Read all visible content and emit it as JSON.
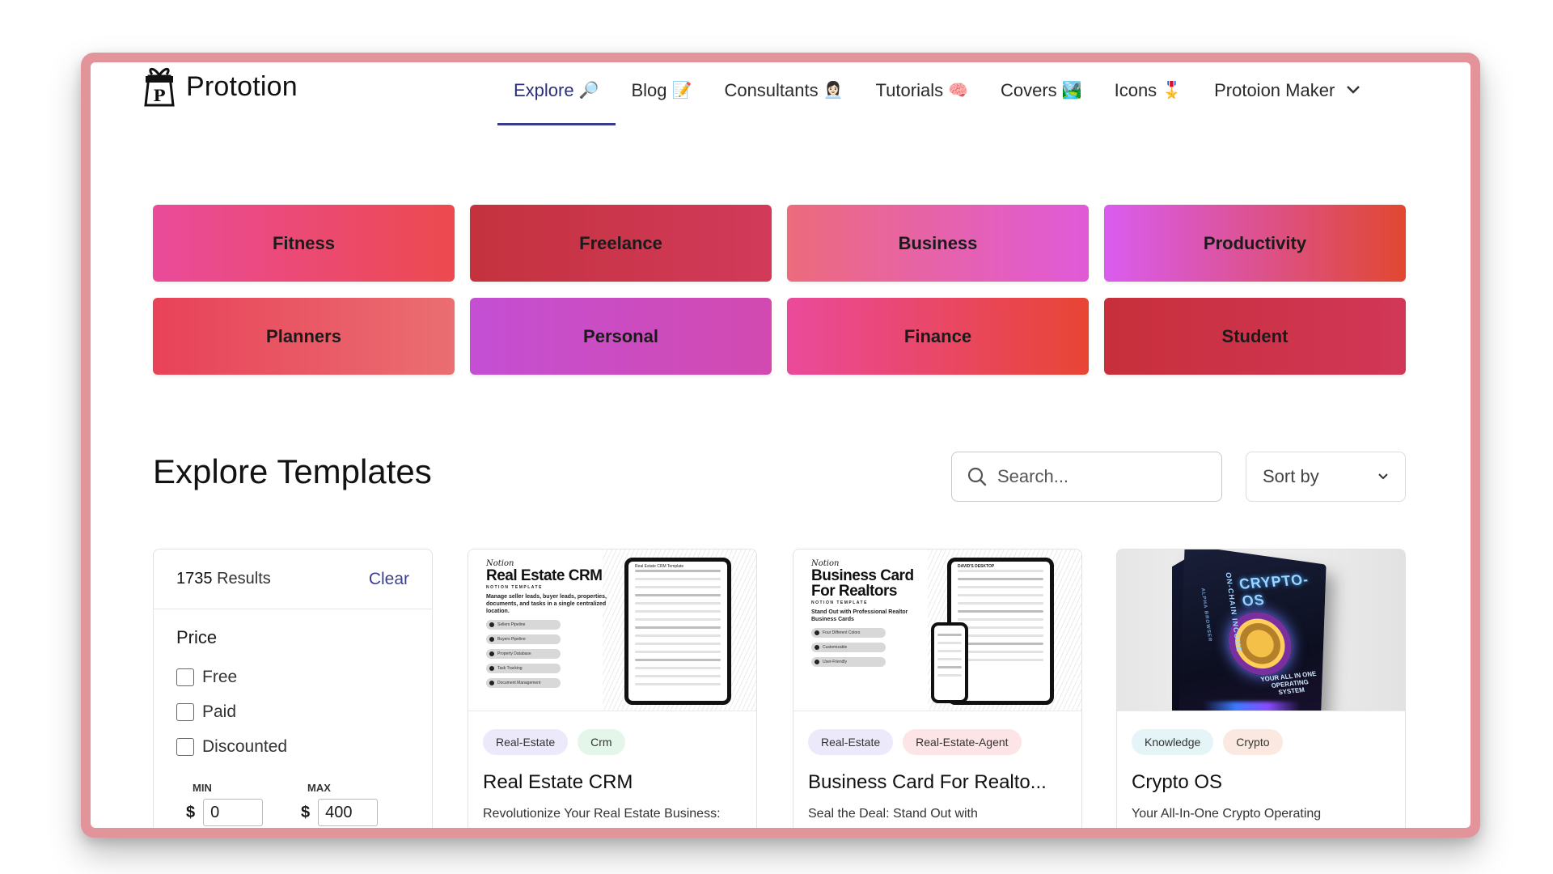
{
  "brand": {
    "name": "Prototion",
    "logo_letter": "P"
  },
  "nav": {
    "items": [
      {
        "label": "Explore",
        "emoji": "🔎",
        "active": true
      },
      {
        "label": "Blog",
        "emoji": "📝"
      },
      {
        "label": "Consultants",
        "emoji": "👩🏻‍💼"
      },
      {
        "label": "Tutorials",
        "emoji": "🧠"
      },
      {
        "label": "Covers",
        "emoji": "🏞️"
      },
      {
        "label": "Icons",
        "emoji": "🎖️"
      }
    ],
    "maker_label": "Protoion Maker",
    "maker_chevron": "⌄"
  },
  "categories": [
    "Fitness",
    "Freelance",
    "Business",
    "Productivity",
    "Planners",
    "Personal",
    "Finance",
    "Student"
  ],
  "explore": {
    "title": "Explore Templates",
    "search_placeholder": "Search...",
    "sort_label": "Sort by",
    "sort_chevron": "⌄"
  },
  "filter": {
    "count": "1735",
    "results_label": "Results",
    "clear_label": "Clear",
    "price_label": "Price",
    "options": [
      "Free",
      "Paid",
      "Discounted"
    ],
    "min_label": "MIN",
    "max_label": "MAX",
    "currency": "$",
    "min_value": "0",
    "max_value": "400"
  },
  "cards": [
    {
      "tags": [
        "Real-Estate",
        "Crm"
      ],
      "title": "Real Estate CRM",
      "desc": "Revolutionize Your Real Estate Business:",
      "thumb": {
        "brand": "Notion",
        "title": "Real Estate CRM",
        "sub": "NOTION TEMPLATE",
        "desc": "Manage seller leads, buyer leads, properties, documents, and tasks in a single centralized location.",
        "pills": [
          "Sellers Pipeline",
          "Buyers Pipeline",
          "Property Database",
          "Task Tracking",
          "Document Management"
        ],
        "screen_title": "Real Estate CRM Template"
      }
    },
    {
      "tags": [
        "Real-Estate",
        "Real-Estate-Agent"
      ],
      "title": "Business Card For Realto...",
      "desc": "Seal the Deal: Stand Out with",
      "thumb": {
        "brand": "Notion",
        "title": "Business Card For Realtors",
        "sub": "NOTION TEMPLATE",
        "desc": "Stand Out with Professional Realtor Business Cards",
        "pills": [
          "Four Different Colors",
          "Customizable",
          "User-Friendly"
        ],
        "screen_title": "DAVID'S DESKTOP"
      }
    },
    {
      "tags": [
        "Knowledge",
        "Crypto"
      ],
      "title": "Crypto OS",
      "desc": "Your All-In-One Crypto Operating",
      "thumb": {
        "box_title": "CRYPTO-OS",
        "box_side": "ON-CHAIN INCOME",
        "box_side_small": "ALPHA BROWSER",
        "box_caption": "YOUR ALL IN ONE OPERATING SYSTEM"
      }
    }
  ],
  "colors": {
    "frame": "#e3949a",
    "active_nav": "#2b2f7a",
    "clear_link": "#3a3f8f"
  }
}
